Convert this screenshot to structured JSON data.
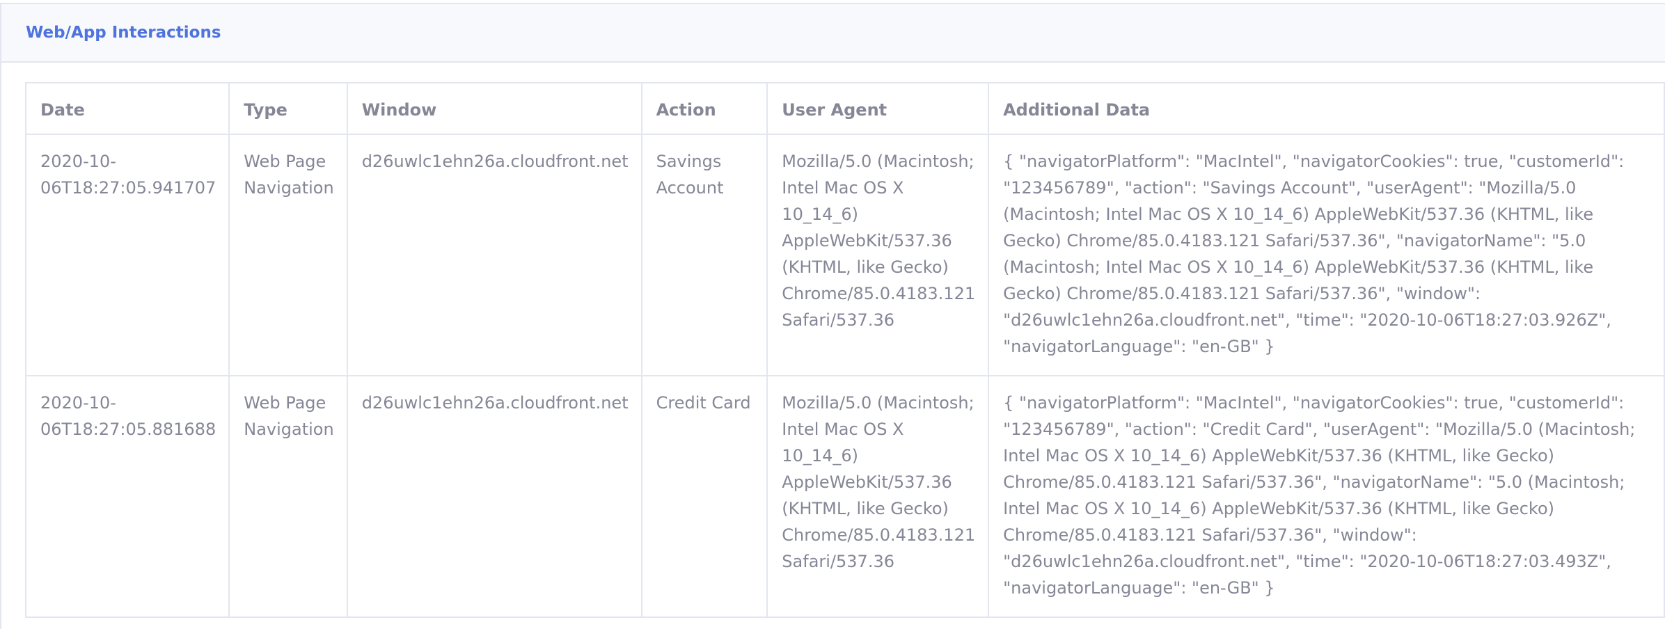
{
  "panel": {
    "title": "Web/App Interactions"
  },
  "table": {
    "columns": [
      "Date",
      "Type",
      "Window",
      "Action",
      "User Agent",
      "Additional Data"
    ],
    "rows": [
      {
        "date_line1": "2020-10-",
        "date_line2": "06T18:27:05.941707",
        "type_line1": "Web Page",
        "type_line2": "Navigation",
        "window": "d26uwlc1ehn26a.cloudfront.net",
        "action_line1": "Savings",
        "action_line2": "Account",
        "user_agent": "Mozilla/5.0 (Macintosh; Intel Mac OS X 10_14_6) AppleWebKit/537.36 (KHTML, like Gecko) Chrome/85.0.4183.121 Safari/537.36",
        "additional_data": "{ \"navigatorPlatform\": \"MacIntel\", \"navigatorCookies\": true, \"customerId\": \"123456789\", \"action\": \"Savings Account\", \"userAgent\": \"Mozilla/5.0 (Macintosh; Intel Mac OS X 10_14_6) AppleWebKit/537.36 (KHTML, like Gecko) Chrome/85.0.4183.121 Safari/537.36\", \"navigatorName\": \"5.0 (Macintosh; Intel Mac OS X 10_14_6) AppleWebKit/537.36 (KHTML, like Gecko) Chrome/85.0.4183.121 Safari/537.36\", \"window\": \"d26uwlc1ehn26a.cloudfront.net\", \"time\": \"2020-10-06T18:27:03.926Z\", \"navigatorLanguage\": \"en-GB\" }"
      },
      {
        "date_line1": "2020-10-",
        "date_line2": "06T18:27:05.881688",
        "type_line1": "Web Page",
        "type_line2": "Navigation",
        "window": "d26uwlc1ehn26a.cloudfront.net",
        "action_line1": "Credit Card",
        "action_line2": "",
        "user_agent": "Mozilla/5.0 (Macintosh; Intel Mac OS X 10_14_6) AppleWebKit/537.36 (KHTML, like Gecko) Chrome/85.0.4183.121 Safari/537.36",
        "additional_data": "{ \"navigatorPlatform\": \"MacIntel\", \"navigatorCookies\": true, \"customerId\": \"123456789\", \"action\": \"Credit Card\", \"userAgent\": \"Mozilla/5.0 (Macintosh; Intel Mac OS X 10_14_6) AppleWebKit/537.36 (KHTML, like Gecko) Chrome/85.0.4183.121 Safari/537.36\", \"navigatorName\": \"5.0 (Macintosh; Intel Mac OS X 10_14_6) AppleWebKit/537.36 (KHTML, like Gecko) Chrome/85.0.4183.121 Safari/537.36\", \"window\": \"d26uwlc1ehn26a.cloudfront.net\", \"time\": \"2020-10-06T18:27:03.493Z\", \"navigatorLanguage\": \"en-GB\" }"
      }
    ]
  },
  "colors": {
    "title": "#4e73df",
    "text": "#858796",
    "border": "#e3e6f0",
    "header_bg": "#f8f9fc"
  }
}
